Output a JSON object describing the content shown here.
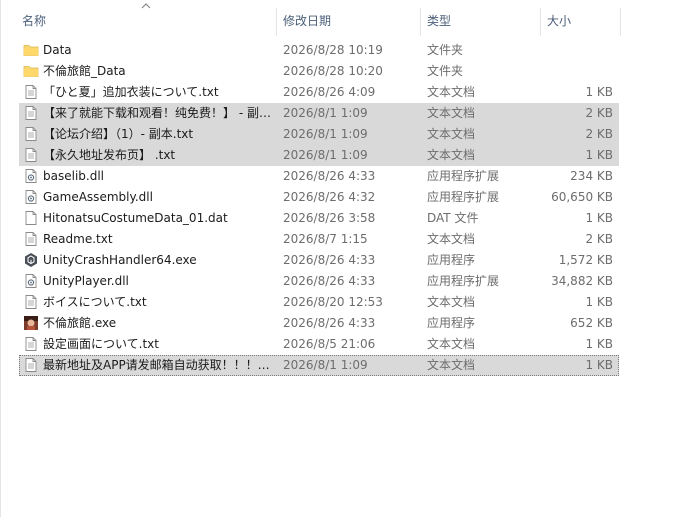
{
  "columns": {
    "name": "名称",
    "date": "修改日期",
    "type": "类型",
    "size": "大小"
  },
  "files": [
    {
      "name": "Data",
      "date": "2026/8/28 10:19",
      "type": "文件夹",
      "size": "",
      "icon": "folder-icon",
      "selected": false
    },
    {
      "name": "不倫旅館_Data",
      "date": "2026/8/28 10:20",
      "type": "文件夹",
      "size": "",
      "icon": "folder-icon",
      "selected": false
    },
    {
      "name": "「ひと夏」追加衣装について.txt",
      "date": "2026/8/26 4:09",
      "type": "文本文档",
      "size": "1 KB",
      "icon": "text-file-icon",
      "selected": false
    },
    {
      "name": "【来了就能下载和观看！纯免费！】 - 副…",
      "date": "2026/8/1 1:09",
      "type": "文本文档",
      "size": "2 KB",
      "icon": "text-file-icon",
      "selected": true
    },
    {
      "name": "【论坛介绍】（1）- 副本.txt",
      "date": "2026/8/1 1:09",
      "type": "文本文档",
      "size": "2 KB",
      "icon": "text-file-icon",
      "selected": true
    },
    {
      "name": "【永久地址发布页】 .txt",
      "date": "2026/8/1 1:09",
      "type": "文本文档",
      "size": "1 KB",
      "icon": "text-file-icon",
      "selected": true
    },
    {
      "name": "baselib.dll",
      "date": "2026/8/26 4:33",
      "type": "应用程序扩展",
      "size": "234 KB",
      "icon": "dll-icon",
      "selected": false
    },
    {
      "name": "GameAssembly.dll",
      "date": "2026/8/26 4:32",
      "type": "应用程序扩展",
      "size": "60,650 KB",
      "icon": "dll-icon",
      "selected": false
    },
    {
      "name": "HitonatsuCostumeData_01.dat",
      "date": "2026/8/26 3:58",
      "type": "DAT 文件",
      "size": "1 KB",
      "icon": "blank-file-icon",
      "selected": false
    },
    {
      "name": "Readme.txt",
      "date": "2026/8/7 1:15",
      "type": "文本文档",
      "size": "2 KB",
      "icon": "text-file-icon",
      "selected": false
    },
    {
      "name": "UnityCrashHandler64.exe",
      "date": "2026/8/26 4:33",
      "type": "应用程序",
      "size": "1,572 KB",
      "icon": "unity-icon",
      "selected": false
    },
    {
      "name": "UnityPlayer.dll",
      "date": "2026/8/26 4:33",
      "type": "应用程序扩展",
      "size": "34,882 KB",
      "icon": "dll-icon",
      "selected": false
    },
    {
      "name": "ボイスについて.txt",
      "date": "2026/8/20 12:53",
      "type": "文本文档",
      "size": "1 KB",
      "icon": "text-file-icon",
      "selected": false
    },
    {
      "name": "不倫旅館.exe",
      "date": "2026/8/26 4:33",
      "type": "应用程序",
      "size": "652 KB",
      "icon": "game-exe-icon",
      "selected": false
    },
    {
      "name": "設定画面について.txt",
      "date": "2026/8/5 21:06",
      "type": "文本文档",
      "size": "1 KB",
      "icon": "text-file-icon",
      "selected": false
    },
    {
      "name": "最新地址及APP请发邮箱自动获取！！！…",
      "date": "2026/8/1 1:09",
      "type": "文本文档",
      "size": "1 KB",
      "icon": "text-file-icon",
      "selected": true
    }
  ],
  "colors": {
    "selected_row": "#d9d9d9",
    "header_text": "#4c607a",
    "folder": "#f8d775"
  }
}
